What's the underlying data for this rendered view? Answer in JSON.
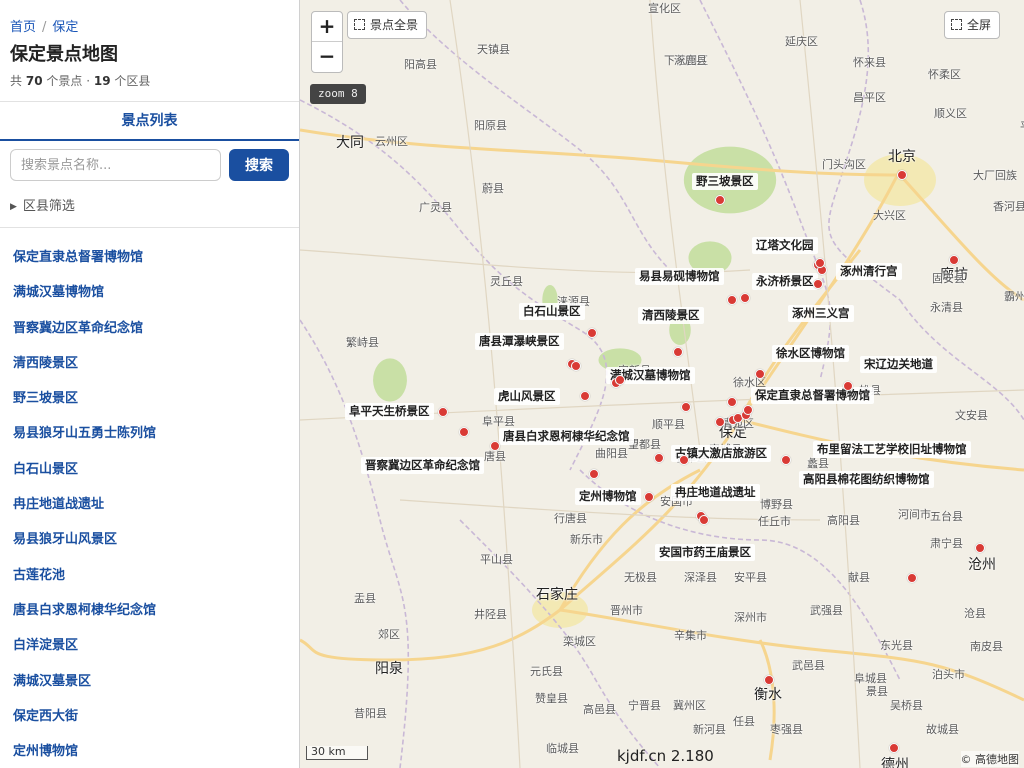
{
  "breadcrumb": {
    "home": "首页",
    "separator": "/",
    "current": "保定"
  },
  "page_title": "保定景点地图",
  "stats": {
    "prefix": "共",
    "spot_count": "70",
    "spot_unit": "个景点 ·",
    "district_count": "19",
    "district_unit": "个区县"
  },
  "tab": {
    "label": "景点列表"
  },
  "search": {
    "placeholder": "搜索景点名称...",
    "button_label": "搜索"
  },
  "filter": {
    "label": "区县筛选"
  },
  "spots": [
    "保定直隶总督署博物馆",
    "满城汉墓博物馆",
    "晋察冀边区革命纪念馆",
    "清西陵景区",
    "野三坡景区",
    "易县狼牙山五勇士陈列馆",
    "白石山景区",
    "冉庄地道战遗址",
    "易县狼牙山风景区",
    "古莲花池",
    "唐县白求恩柯棣华纪念馆",
    "白洋淀景区",
    "满城汉墓景区",
    "保定西大街",
    "定州博物馆"
  ],
  "map": {
    "zoom_in": "+",
    "zoom_out": "−",
    "full_view_label": "景点全景",
    "fullscreen_label": "全屏",
    "zoom_badge": "zoom 8",
    "scale_label": "30 km",
    "watermark": "kjdf.cn 2.180",
    "attribution": "© 高德地图",
    "colors": {
      "land": "#f2efe6",
      "forest": "#c9e0a6",
      "road": "#f6d58e",
      "border": "#c9b8d6",
      "marker": "#d93a35",
      "city": "#f3e7a8"
    },
    "cities": [
      "北京",
      "石家庄",
      "大同",
      "廊坊",
      "沧州",
      "衡水",
      "阳泉",
      "德州",
      "保定"
    ],
    "places": [
      "宣化区",
      "延庆区",
      "下花园区",
      "涿鹿县",
      "怀来县",
      "怀柔区",
      "阳高县",
      "天镇县",
      "昌平区",
      "顺义区",
      "云州区",
      "阳原县",
      "门头沟区",
      "平谷区",
      "大厂回族",
      "香河县",
      "蔚县",
      "广灵县",
      "大兴区",
      "灵丘县",
      "涞源县",
      "固安县",
      "永清县",
      "霸州市",
      "繁峙县",
      "安新县",
      "文安县",
      "徐水区",
      "雄县",
      "阜平县",
      "望都县",
      "顺平县",
      "清苑区",
      "安国市",
      "博野县",
      "任丘市",
      "河间市",
      "五台县",
      "唐县",
      "曲阳县",
      "行唐县",
      "新乐市",
      "无极县",
      "深泽县",
      "安平县",
      "肃宁县",
      "献县",
      "平山县",
      "井陉县",
      "晋州市",
      "深州市",
      "武强县",
      "盂县",
      "郊区",
      "栾城区",
      "辛集市",
      "武邑县",
      "阜城县",
      "昔阳县",
      "元氏县",
      "赞皇县",
      "高邑县",
      "宁晋县",
      "冀州区",
      "景县",
      "吴桥县",
      "沧县",
      "泊头市",
      "南皮县",
      "东光县",
      "临城县",
      "新河县",
      "枣强县",
      "故城县",
      "宁津县",
      "蠡县",
      "高阳县",
      "任县",
      "容城县"
    ],
    "pois": [
      "野三坡景区",
      "辽塔文化园",
      "易县易砚博物馆",
      "永济桥景区",
      "涿州清行宫",
      "白石山景区",
      "清西陵景区",
      "涿州三义宫",
      "唐县潭瀑峡景区",
      "徐水区博物馆",
      "满城汉墓博物馆",
      "宋辽边关地道",
      "虎山风景区",
      "保定直隶总督署博物馆",
      "阜平天生桥景区",
      "唐县白求恩柯棣华纪念馆",
      "古镇大激店旅游区",
      "布里留法工艺学校旧址博物馆",
      "晋察冀边区革命纪念馆",
      "高阳县棉花图纺织博物馆",
      "定州博物馆",
      "冉庄地道战遗址",
      "安国市药王庙景区"
    ]
  }
}
